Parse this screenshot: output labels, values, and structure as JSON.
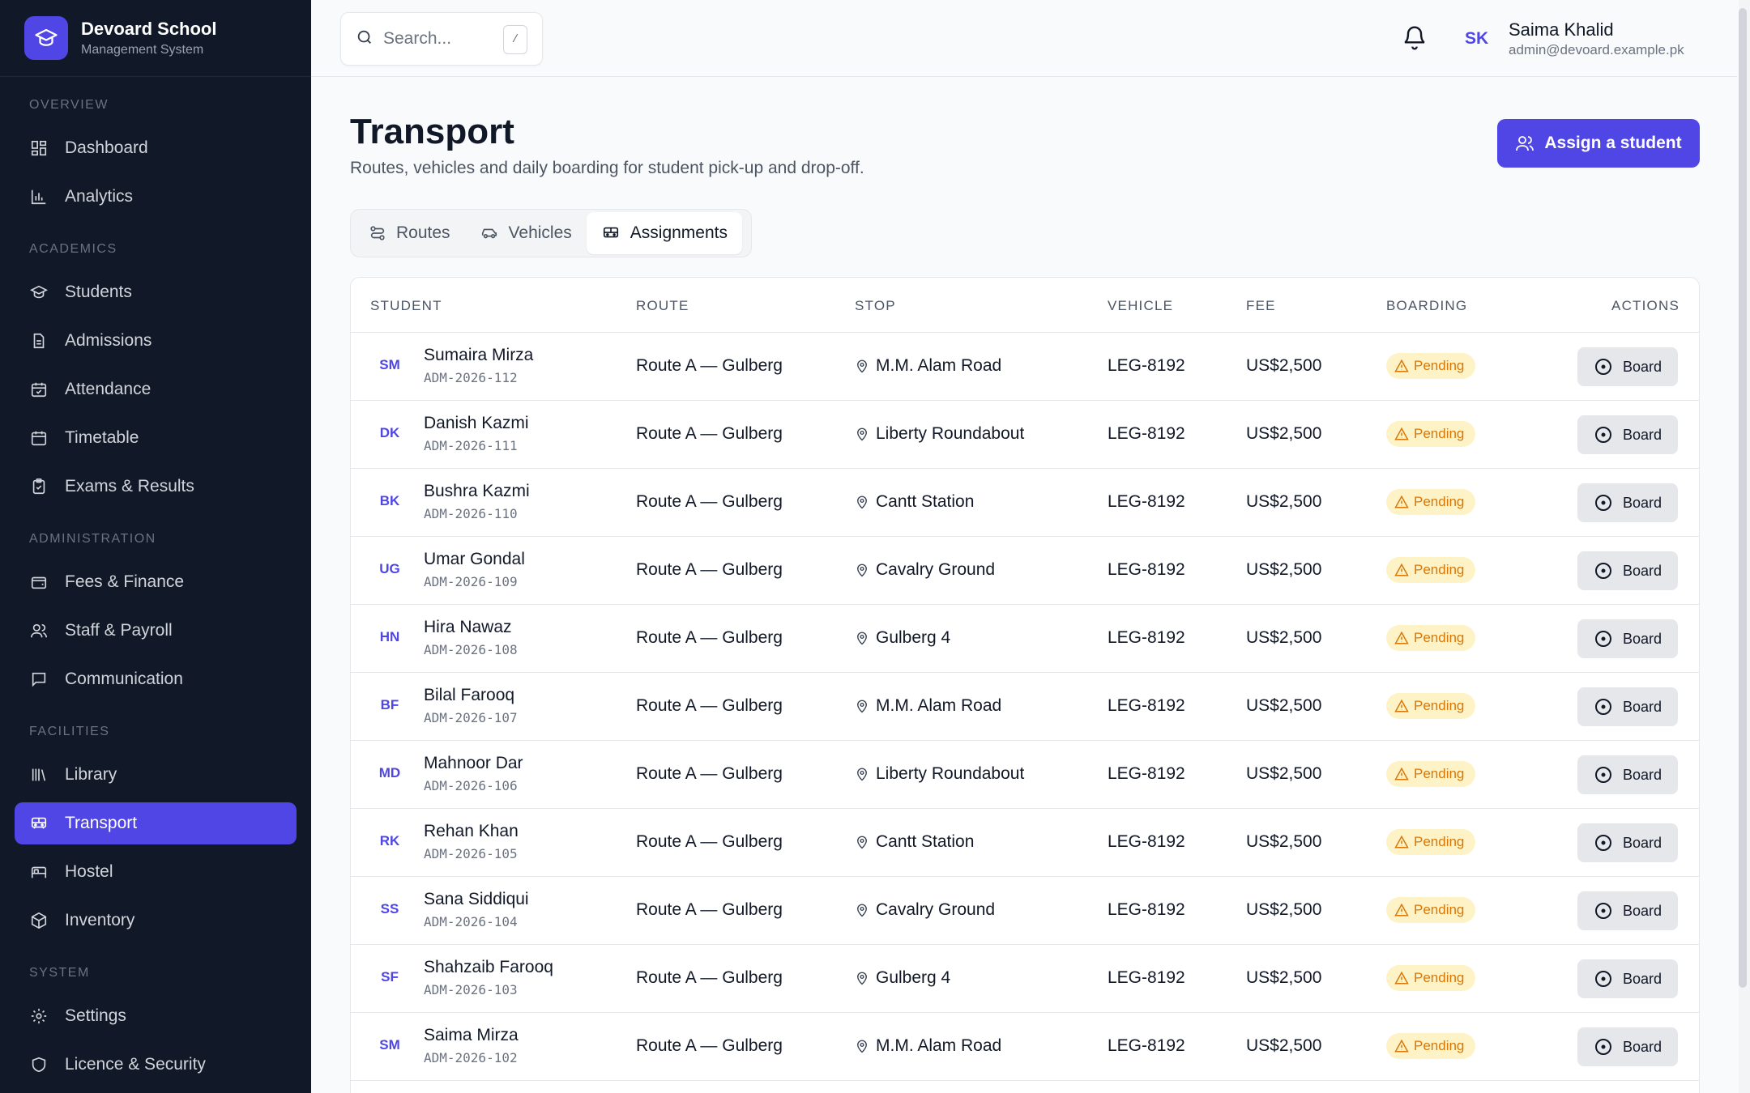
{
  "brand": {
    "name": "Devoard School",
    "subtitle": "Management System",
    "accent": "#4f46e5"
  },
  "sidebar": {
    "sections": [
      {
        "label": "OVERVIEW",
        "items": [
          {
            "label": "Dashboard",
            "icon": "grid-icon"
          },
          {
            "label": "Analytics",
            "icon": "bar-chart-icon"
          }
        ]
      },
      {
        "label": "ACADEMICS",
        "items": [
          {
            "label": "Students",
            "icon": "graduation-cap-icon"
          },
          {
            "label": "Admissions",
            "icon": "file-icon"
          },
          {
            "label": "Attendance",
            "icon": "calendar-check-icon"
          },
          {
            "label": "Timetable",
            "icon": "calendar-icon"
          },
          {
            "label": "Exams & Results",
            "icon": "clipboard-icon"
          }
        ]
      },
      {
        "label": "ADMINISTRATION",
        "items": [
          {
            "label": "Fees & Finance",
            "icon": "wallet-icon"
          },
          {
            "label": "Staff & Payroll",
            "icon": "users-icon"
          },
          {
            "label": "Communication",
            "icon": "message-icon"
          }
        ]
      },
      {
        "label": "FACILITIES",
        "items": [
          {
            "label": "Library",
            "icon": "library-icon"
          },
          {
            "label": "Transport",
            "icon": "bus-icon",
            "active": true
          },
          {
            "label": "Hostel",
            "icon": "bed-icon"
          },
          {
            "label": "Inventory",
            "icon": "package-icon"
          }
        ]
      },
      {
        "label": "SYSTEM",
        "items": [
          {
            "label": "Settings",
            "icon": "gear-icon"
          },
          {
            "label": "Licence & Security",
            "icon": "shield-icon"
          }
        ]
      }
    ]
  },
  "topbar": {
    "search_placeholder": "Search...",
    "search_shortcut": "/",
    "user": {
      "initials": "SK",
      "name": "Saima Khalid",
      "email": "admin@devoard.example.pk"
    }
  },
  "page": {
    "title": "Transport",
    "subtitle": "Routes, vehicles and daily boarding for student pick-up and drop-off.",
    "primary_action": "Assign a student",
    "tabs": [
      {
        "label": "Routes",
        "icon": "route-icon"
      },
      {
        "label": "Vehicles",
        "icon": "car-icon"
      },
      {
        "label": "Assignments",
        "icon": "bus-icon",
        "active": true
      }
    ]
  },
  "table": {
    "columns": [
      "STUDENT",
      "ROUTE",
      "STOP",
      "VEHICLE",
      "FEE",
      "BOARDING",
      "ACTIONS"
    ],
    "rows": [
      {
        "initials": "SM",
        "name": "Sumaira Mirza",
        "id": "ADM-2026-112",
        "route": "Route A — Gulberg",
        "stop": "M.M. Alam Road",
        "vehicle": "LEG-8192",
        "fee": "US$2,500",
        "status": "Pending",
        "action": "Board"
      },
      {
        "initials": "DK",
        "name": "Danish Kazmi",
        "id": "ADM-2026-111",
        "route": "Route A — Gulberg",
        "stop": "Liberty Roundabout",
        "vehicle": "LEG-8192",
        "fee": "US$2,500",
        "status": "Pending",
        "action": "Board"
      },
      {
        "initials": "BK",
        "name": "Bushra Kazmi",
        "id": "ADM-2026-110",
        "route": "Route A — Gulberg",
        "stop": "Cantt Station",
        "vehicle": "LEG-8192",
        "fee": "US$2,500",
        "status": "Pending",
        "action": "Board"
      },
      {
        "initials": "UG",
        "name": "Umar Gondal",
        "id": "ADM-2026-109",
        "route": "Route A — Gulberg",
        "stop": "Cavalry Ground",
        "vehicle": "LEG-8192",
        "fee": "US$2,500",
        "status": "Pending",
        "action": "Board"
      },
      {
        "initials": "HN",
        "name": "Hira Nawaz",
        "id": "ADM-2026-108",
        "route": "Route A — Gulberg",
        "stop": "Gulberg 4",
        "vehicle": "LEG-8192",
        "fee": "US$2,500",
        "status": "Pending",
        "action": "Board"
      },
      {
        "initials": "BF",
        "name": "Bilal Farooq",
        "id": "ADM-2026-107",
        "route": "Route A — Gulberg",
        "stop": "M.M. Alam Road",
        "vehicle": "LEG-8192",
        "fee": "US$2,500",
        "status": "Pending",
        "action": "Board"
      },
      {
        "initials": "MD",
        "name": "Mahnoor Dar",
        "id": "ADM-2026-106",
        "route": "Route A — Gulberg",
        "stop": "Liberty Roundabout",
        "vehicle": "LEG-8192",
        "fee": "US$2,500",
        "status": "Pending",
        "action": "Board"
      },
      {
        "initials": "RK",
        "name": "Rehan Khan",
        "id": "ADM-2026-105",
        "route": "Route A — Gulberg",
        "stop": "Cantt Station",
        "vehicle": "LEG-8192",
        "fee": "US$2,500",
        "status": "Pending",
        "action": "Board"
      },
      {
        "initials": "SS",
        "name": "Sana Siddiqui",
        "id": "ADM-2026-104",
        "route": "Route A — Gulberg",
        "stop": "Cavalry Ground",
        "vehicle": "LEG-8192",
        "fee": "US$2,500",
        "status": "Pending",
        "action": "Board"
      },
      {
        "initials": "SF",
        "name": "Shahzaib Farooq",
        "id": "ADM-2026-103",
        "route": "Route A — Gulberg",
        "stop": "Gulberg 4",
        "vehicle": "LEG-8192",
        "fee": "US$2,500",
        "status": "Pending",
        "action": "Board"
      },
      {
        "initials": "SM",
        "name": "Saima Mirza",
        "id": "ADM-2026-102",
        "route": "Route A — Gulberg",
        "stop": "M.M. Alam Road",
        "vehicle": "LEG-8192",
        "fee": "US$2,500",
        "status": "Pending",
        "action": "Board"
      }
    ]
  },
  "colors": {
    "sidebar_bg": "#111827",
    "pending_bg": "#fef3c7",
    "pending_text": "#d97706"
  }
}
